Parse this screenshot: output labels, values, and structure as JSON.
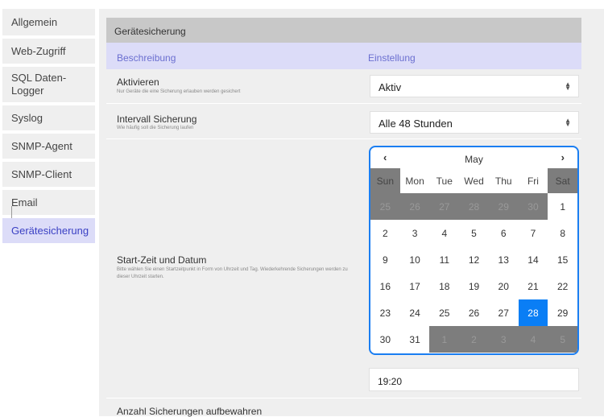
{
  "sidebar": {
    "items": [
      {
        "label": "Allgemein"
      },
      {
        "label": "Web-Zugriff"
      },
      {
        "label": "SQL Daten-Logger"
      },
      {
        "label": "Syslog"
      },
      {
        "label": "SNMP-Agent"
      },
      {
        "label": "SNMP-Client"
      },
      {
        "label": "Email"
      },
      {
        "label": "Gerätesicherung",
        "active": true
      }
    ]
  },
  "section": {
    "title": "Gerätesicherung",
    "col_description": "Beschreibung",
    "col_setting": "Einstellung"
  },
  "rows": {
    "activate": {
      "label": "Aktivieren",
      "hint": "Nur Geräte die eine Sicherung erlauben werden gesichert",
      "value": "Aktiv"
    },
    "interval": {
      "label": "Intervall Sicherung",
      "hint": "Wie häufig soll die Sicherung laufen",
      "value": "Alle 48 Stunden"
    },
    "start": {
      "label": "Start-Zeit und Datum",
      "hint": "Bitte wählen Sie einen Startzeitpunkt in Form von Uhrzeit und Tag. Wiederkehrende Sicherungen werden zu dieser Uhrzeit starten.",
      "time_value": "19:20"
    },
    "keep": {
      "label": "Anzahl Sicherungen aufbewahren"
    }
  },
  "calendar": {
    "prev": "‹",
    "next": "›",
    "month": "May",
    "weekdays": [
      "Sun",
      "Mon",
      "Tue",
      "Wed",
      "Thu",
      "Fri",
      "Sat"
    ],
    "weeks": [
      [
        "25",
        "26",
        "27",
        "28",
        "29",
        "30",
        "1"
      ],
      [
        "2",
        "3",
        "4",
        "5",
        "6",
        "7",
        "8"
      ],
      [
        "9",
        "10",
        "11",
        "12",
        "13",
        "14",
        "15"
      ],
      [
        "16",
        "17",
        "18",
        "19",
        "20",
        "21",
        "22"
      ],
      [
        "23",
        "24",
        "25",
        "26",
        "27",
        "28",
        "29"
      ],
      [
        "30",
        "31",
        "1",
        "2",
        "3",
        "4",
        "5"
      ]
    ],
    "selected_day": "28",
    "colors": {
      "accent": "#0a7ef5",
      "outside": "#7d7d7d"
    }
  },
  "icons": {
    "select_arrows": "up-down-chevron-icon"
  }
}
